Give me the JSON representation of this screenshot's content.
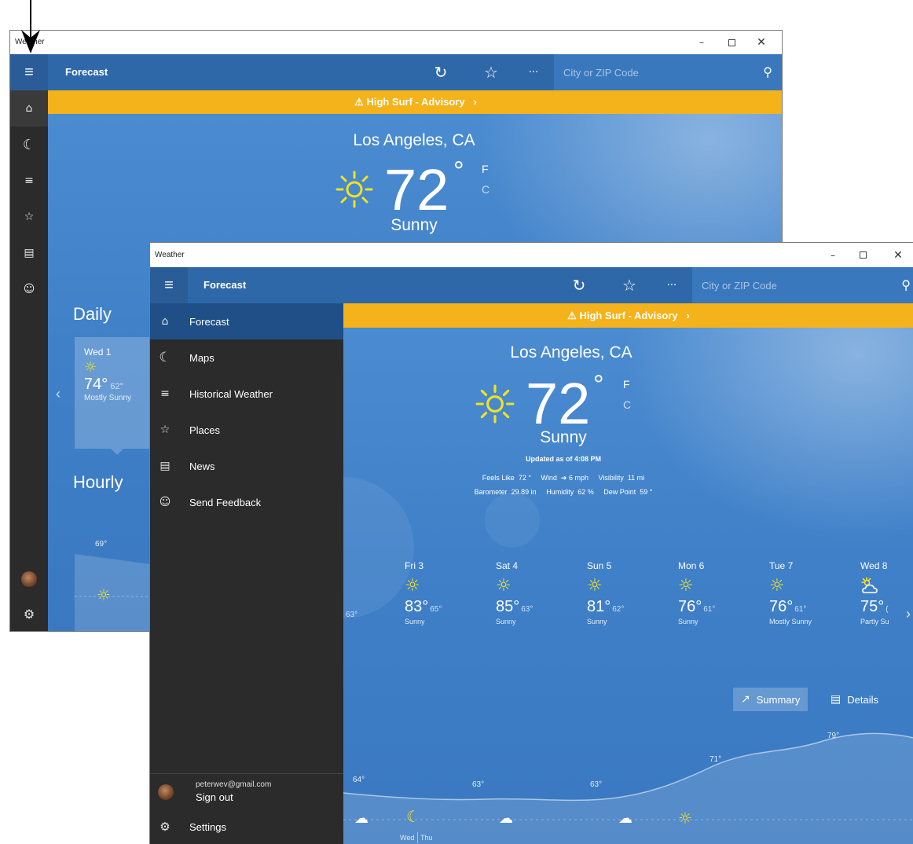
{
  "colors": {
    "accent_bar": "#2f68a8",
    "advisory": "#f4b21b",
    "sky": "#3f80c8",
    "drawer": "#2b2b2b",
    "drawer_active": "#1f4f86",
    "sun": "#f2e21f"
  },
  "back_window": {
    "title": "Weather",
    "app_title": "Forecast",
    "search_placeholder": "City or ZIP Code",
    "advisory": "⚠ High Surf - Advisory   ›",
    "city": "Los Angeles, CA",
    "temperature": "72",
    "degree": "°",
    "unit_f": "F",
    "unit_c": "C",
    "condition": "Sunny",
    "daily_heading": "Daily",
    "hourly_heading": "Hourly",
    "daily_card": {
      "day": "Wed 1",
      "high": "74°",
      "low": "62°",
      "condition": "Mostly Sunny"
    },
    "hourly_first_temp": "69°",
    "prev_arrow": "‹",
    "rail_icons": [
      "home-icon",
      "maps-icon",
      "historical-icon",
      "places-icon",
      "news-icon",
      "feedback-icon",
      "avatar",
      "settings-icon"
    ]
  },
  "front_window": {
    "title": "Weather",
    "app_title": "Forecast",
    "search_placeholder": "City or ZIP Code",
    "advisory": "⚠ High Surf - Advisory   ›",
    "nav_items": [
      {
        "label": "Forecast",
        "icon": "home-icon"
      },
      {
        "label": "Maps",
        "icon": "maps-icon"
      },
      {
        "label": "Historical Weather",
        "icon": "historical-icon"
      },
      {
        "label": "Places",
        "icon": "places-icon"
      },
      {
        "label": "News",
        "icon": "news-icon"
      },
      {
        "label": "Send Feedback",
        "icon": "feedback-icon"
      }
    ],
    "account_email": "peterwev@gmail.com",
    "sign_out": "Sign out",
    "settings": "Settings",
    "city": "Los Angeles, CA",
    "temperature": "72",
    "degree": "°",
    "unit_f": "F",
    "unit_c": "C",
    "condition": "Sunny",
    "updated": "Updated as of 4:08 PM",
    "details_line1": "Feels Like  72 °     Wind  ➔ 6 mph     Visibility  11 mi",
    "details_line2": "Barometer  29.89 in     Humidity  62 %     Dew Point  59 °",
    "partial_low": "63°",
    "next_arrow": "›",
    "forecast_days": [
      {
        "day": "Fri 3",
        "high": "83°",
        "low": "65°",
        "condition": "Sunny",
        "icon": "sun-icon"
      },
      {
        "day": "Sat 4",
        "high": "85°",
        "low": "63°",
        "condition": "Sunny",
        "icon": "sun-icon"
      },
      {
        "day": "Sun 5",
        "high": "81°",
        "low": "62°",
        "condition": "Sunny",
        "icon": "sun-icon"
      },
      {
        "day": "Mon 6",
        "high": "76°",
        "low": "61°",
        "condition": "Sunny",
        "icon": "sun-icon"
      },
      {
        "day": "Tue 7",
        "high": "76°",
        "low": "61°",
        "condition": "Mostly Sunny",
        "icon": "sun-icon"
      },
      {
        "day": "Wed 8",
        "high": "75°",
        "low": "(",
        "condition": "Partly Su",
        "icon": "partly-cloudy-icon"
      }
    ],
    "toggle_summary": "Summary",
    "toggle_details": "Details",
    "hourly_temps": [
      "64°",
      "63°",
      "63°",
      "71°",
      "79°"
    ],
    "hourly_day_labels": [
      "Wed",
      "Thu"
    ]
  }
}
